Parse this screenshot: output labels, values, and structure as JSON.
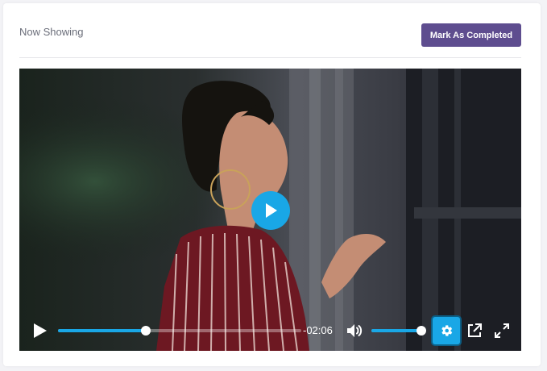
{
  "card": {
    "title": "Now Showing",
    "complete_button_label": "Mark As Completed"
  },
  "player": {
    "icons": {
      "big_play": "play-icon",
      "play": "play-icon",
      "mute": "volume-icon",
      "settings": "gear-icon",
      "popout": "external-link-icon",
      "fullscreen": "fullscreen-icon"
    },
    "progress_fraction": 0.36,
    "time_remaining": "-02:06",
    "volume_fraction": 1.0
  },
  "colors": {
    "accent": "#19a7e6",
    "button_purple": "#5e4d8f",
    "control_white": "#ffffff"
  }
}
